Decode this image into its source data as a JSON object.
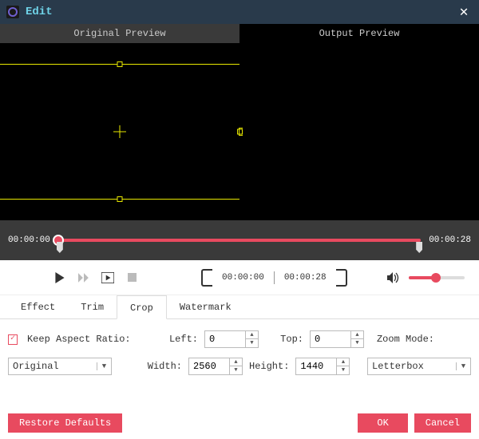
{
  "window": {
    "title": "Edit"
  },
  "preview": {
    "original_label": "Original Preview",
    "output_label": "Output Preview"
  },
  "timeline": {
    "start": "00:00:00",
    "end": "00:00:28"
  },
  "playback": {
    "in_time": "00:00:00",
    "out_time": "00:00:28"
  },
  "tabs": {
    "effect": "Effect",
    "trim": "Trim",
    "crop": "Crop",
    "watermark": "Watermark"
  },
  "crop": {
    "keep_aspect_label": "Keep Aspect Ratio:",
    "left_label": "Left:",
    "left_value": "0",
    "top_label": "Top:",
    "top_value": "0",
    "width_label": "Width:",
    "width_value": "2560",
    "height_label": "Height:",
    "height_value": "1440",
    "aspect_select": "Original",
    "zoom_mode_label": "Zoom Mode:",
    "zoom_mode_value": "Letterbox"
  },
  "footer": {
    "restore": "Restore Defaults",
    "ok": "OK",
    "cancel": "Cancel"
  }
}
